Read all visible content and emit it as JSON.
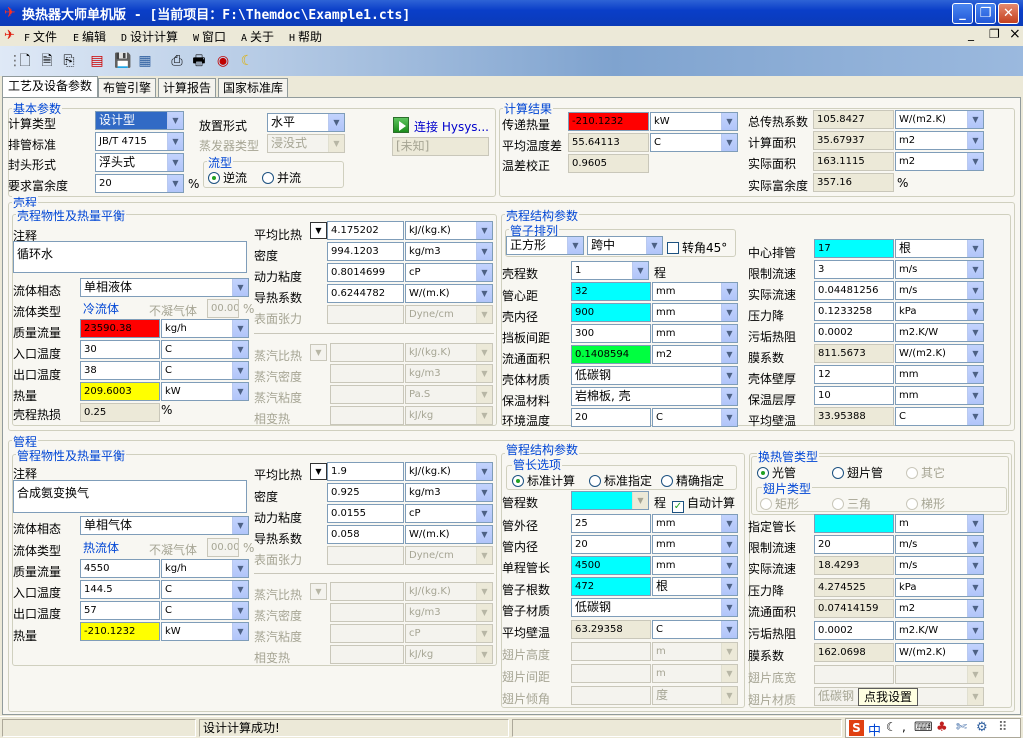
{
  "window": {
    "title": "换热器大师单机版 - [当前项目：F:\\Themdoc\\Example1.cts]",
    "min": "_",
    "max": "❐",
    "close": "✕",
    "mdi_min": "_",
    "mdi_max": "❐",
    "mdi_close": "×"
  },
  "menu": [
    {
      "key": "F",
      "label": "文件"
    },
    {
      "key": "E",
      "label": "编辑"
    },
    {
      "key": "D",
      "label": "设计计算"
    },
    {
      "key": "W",
      "label": "窗口"
    },
    {
      "key": "A",
      "label": "关于"
    },
    {
      "key": "H",
      "label": "帮助"
    }
  ],
  "tabs": [
    "工艺及设备参数",
    "布管引擎",
    "计算报告",
    "国家标准库"
  ],
  "basic": {
    "title": "基本参数",
    "calc_type_label": "计算类型",
    "calc_type": "设计型",
    "tube_std_label": "排管标准",
    "tube_std": "JB/T 4715",
    "head_label": "封头形式",
    "head": "浮头式",
    "margin_label": "要求富余度",
    "margin": "20",
    "margin_unit": "%",
    "placement_label": "放置形式",
    "placement": "水平",
    "evap_label": "蒸发器类型",
    "evap": "浸没式",
    "flow_title": "流型",
    "flow_counter": "逆流",
    "flow_parallel": "并流",
    "hysys_label": "连接 Hysys...",
    "hysys_value": "[未知]"
  },
  "results": {
    "title": "计算结果",
    "q_label": "传递热量",
    "q": "-210.1232",
    "q_unit": "kW",
    "lmtd_label": "平均温度差",
    "lmtd": "55.64113",
    "lmtd_unit": "C",
    "ft_label": "温差校正",
    "ft": "0.9605",
    "u_label": "总传热系数",
    "u": "105.8427",
    "u_unit": "W/(m2.K)",
    "acalc_label": "计算面积",
    "acalc": "35.67937",
    "acalc_unit": "m2",
    "aact_label": "实际面积",
    "aact": "163.1115",
    "aact_unit": "m2",
    "excess_label": "实际富余度",
    "excess": "357.16",
    "excess_unit": "%"
  },
  "shell": {
    "title": "壳程",
    "props_title": "壳程物性及热量平衡",
    "note_label": "注释",
    "note": "循环水",
    "phase_label": "流体相态",
    "phase": "单相液体",
    "ftype_label": "流体类型",
    "ftype": "冷流体",
    "noncond_label": "不凝气体",
    "noncond": "00.00",
    "noncond_unit": "%",
    "mass_label": "质量流量",
    "mass": "23590.38",
    "mass_unit": "kg/h",
    "tin_label": "入口温度",
    "tin": "30",
    "tin_unit": "C",
    "tout_label": "出口温度",
    "tout": "38",
    "tout_unit": "C",
    "heat_label": "热量",
    "heat": "209.6003",
    "heat_unit": "kW",
    "loss_label": "壳程热损",
    "loss": "0.25",
    "loss_unit": "%",
    "cp_label": "平均比热",
    "cp": "4.175202",
    "cp_unit": "kJ/(kg.K)",
    "rho_label": "密度",
    "rho": "994.1203",
    "rho_unit": "kg/m3",
    "mu_label": "动力粘度",
    "mu": "0.8014699",
    "mu_unit": "cP",
    "k_label": "导热系数",
    "k": "0.6244782",
    "k_unit": "W/(m.K)",
    "st_label": "表面张力",
    "st_unit": "Dyne/cm",
    "vcp_label": "蒸汽比热",
    "vcp_unit": "kJ/(kg.K)",
    "vrho_label": "蒸汽密度",
    "vrho_unit": "kg/m3",
    "vmu_label": "蒸汽粘度",
    "vmu_unit": "Pa.S",
    "lat_label": "相变热",
    "lat_unit": "kJ/kg",
    "struct_title": "壳程结构参数",
    "layout_title": "管子排列",
    "layout": "正方形",
    "layout2": "跨中",
    "rot45": "转角45°",
    "npass_label": "壳程数",
    "npass": "1",
    "npass_unit": "程",
    "pitch_label": "管心距",
    "pitch": "32",
    "pitch_unit": "mm",
    "did_label": "壳内径",
    "did": "900",
    "did_unit": "mm",
    "baffle_label": "挡板间距",
    "baffle": "300",
    "baffle_unit": "mm",
    "area_label": "流通面积",
    "area": "0.1408594",
    "area_unit": "m2",
    "mat_label": "壳体材质",
    "mat": "低碳钢",
    "ins_label": "保温材料",
    "ins": "岩棉板, 壳",
    "tamb_label": "环境温度",
    "tamb": "20",
    "tamb_unit": "C",
    "nc_label": "中心排管",
    "nc": "17",
    "nc_unit": "根",
    "vlim_label": "限制流速",
    "vlim": "3",
    "vlim_unit": "m/s",
    "v_label": "实际流速",
    "v": "0.04481256",
    "v_unit": "m/s",
    "dp_label": "压力降",
    "dp": "0.1233258",
    "dp_unit": "kPa",
    "rf_label": "污垢热阻",
    "rf": "0.0002",
    "rf_unit": "m2.K/W",
    "h_label": "膜系数",
    "h": "811.5673",
    "h_unit": "W/(m2.K)",
    "wt_label": "壳体壁厚",
    "wt": "12",
    "wt_unit": "mm",
    "it_label": "保温层厚",
    "it": "10",
    "it_unit": "mm",
    "tw_label": "平均壁温",
    "tw": "33.95388",
    "tw_unit": "C"
  },
  "tube": {
    "title": "管程",
    "props_title": "管程物性及热量平衡",
    "note_label": "注释",
    "note": "合成氨变换气",
    "phase_label": "流体相态",
    "phase": "单相气体",
    "ftype_label": "流体类型",
    "ftype": "热流体",
    "noncond_label": "不凝气体",
    "noncond": "00.00",
    "noncond_unit": "%",
    "mass_label": "质量流量",
    "mass": "4550",
    "mass_unit": "kg/h",
    "tin_label": "入口温度",
    "tin": "144.5",
    "tin_unit": "C",
    "tout_label": "出口温度",
    "tout": "57",
    "tout_unit": "C",
    "heat_label": "热量",
    "heat": "-210.1232",
    "heat_unit": "kW",
    "cp_label": "平均比热",
    "cp": "1.9",
    "cp_unit": "kJ/(kg.K)",
    "rho_label": "密度",
    "rho": "0.925",
    "rho_unit": "kg/m3",
    "mu_label": "动力粘度",
    "mu": "0.0155",
    "mu_unit": "cP",
    "k_label": "导热系数",
    "k": "0.058",
    "k_unit": "W/(m.K)",
    "st_label": "表面张力",
    "st_unit": "Dyne/cm",
    "vcp_label": "蒸汽比热",
    "vcp_unit": "kJ/(kg.K)",
    "vrho_label": "蒸汽密度",
    "vrho_unit": "kg/m3",
    "vmu_label": "蒸汽粘度",
    "vmu_unit": "cP",
    "lat_label": "相变热",
    "lat_unit": "kJ/kg",
    "struct_title": "管程结构参数",
    "len_title": "管长选项",
    "len_std_calc": "标准计算",
    "len_std_set": "标准指定",
    "len_exact": "精确指定",
    "npass_label": "管程数",
    "npass_unit": "程",
    "auto_calc": "自动计算",
    "do_label": "管外径",
    "do": "25",
    "do_unit": "mm",
    "di_label": "管内径",
    "di": "20",
    "di_unit": "mm",
    "L_label": "单程管长",
    "L": "4500",
    "L_unit": "mm",
    "nt_label": "管子根数",
    "nt": "472",
    "nt_unit": "根",
    "mat_label": "管子材质",
    "mat": "低碳钢",
    "tw_label": "平均壁温",
    "tw": "63.29358",
    "tw_unit": "C",
    "fh_label": "翅片高度",
    "fh_unit": "m",
    "fs_label": "翅片间距",
    "fs_unit": "m",
    "fa_label": "翅片倾角",
    "fa_unit": "度",
    "type_title": "换热管类型",
    "smooth": "光管",
    "finned": "翅片管",
    "other": "其它",
    "fin_title": "翅片类型",
    "rect": "矩形",
    "tri": "三角",
    "trap": "梯形",
    "Lset_label": "指定管长",
    "Lset_unit": "m",
    "vlim_label": "限制流速",
    "vlim": "20",
    "vlim_unit": "m/s",
    "v_label": "实际流速",
    "v": "18.4293",
    "v_unit": "m/s",
    "dp_label": "压力降",
    "dp": "4.274525",
    "dp_unit": "kPa",
    "area_label": "流通面积",
    "area": "0.07414159",
    "area_unit": "m2",
    "rf_label": "污垢热阻",
    "rf": "0.0002",
    "rf_unit": "m2.K/W",
    "h_label": "膜系数",
    "h": "162.0698",
    "h_unit": "W/(m2.K)",
    "fb_label": "翅片底宽",
    "fin_mat_label": "翅片材质",
    "fin_mat": "低碳钢",
    "point_btn": "点我设置"
  },
  "status": {
    "text": "设计计算成功!"
  }
}
